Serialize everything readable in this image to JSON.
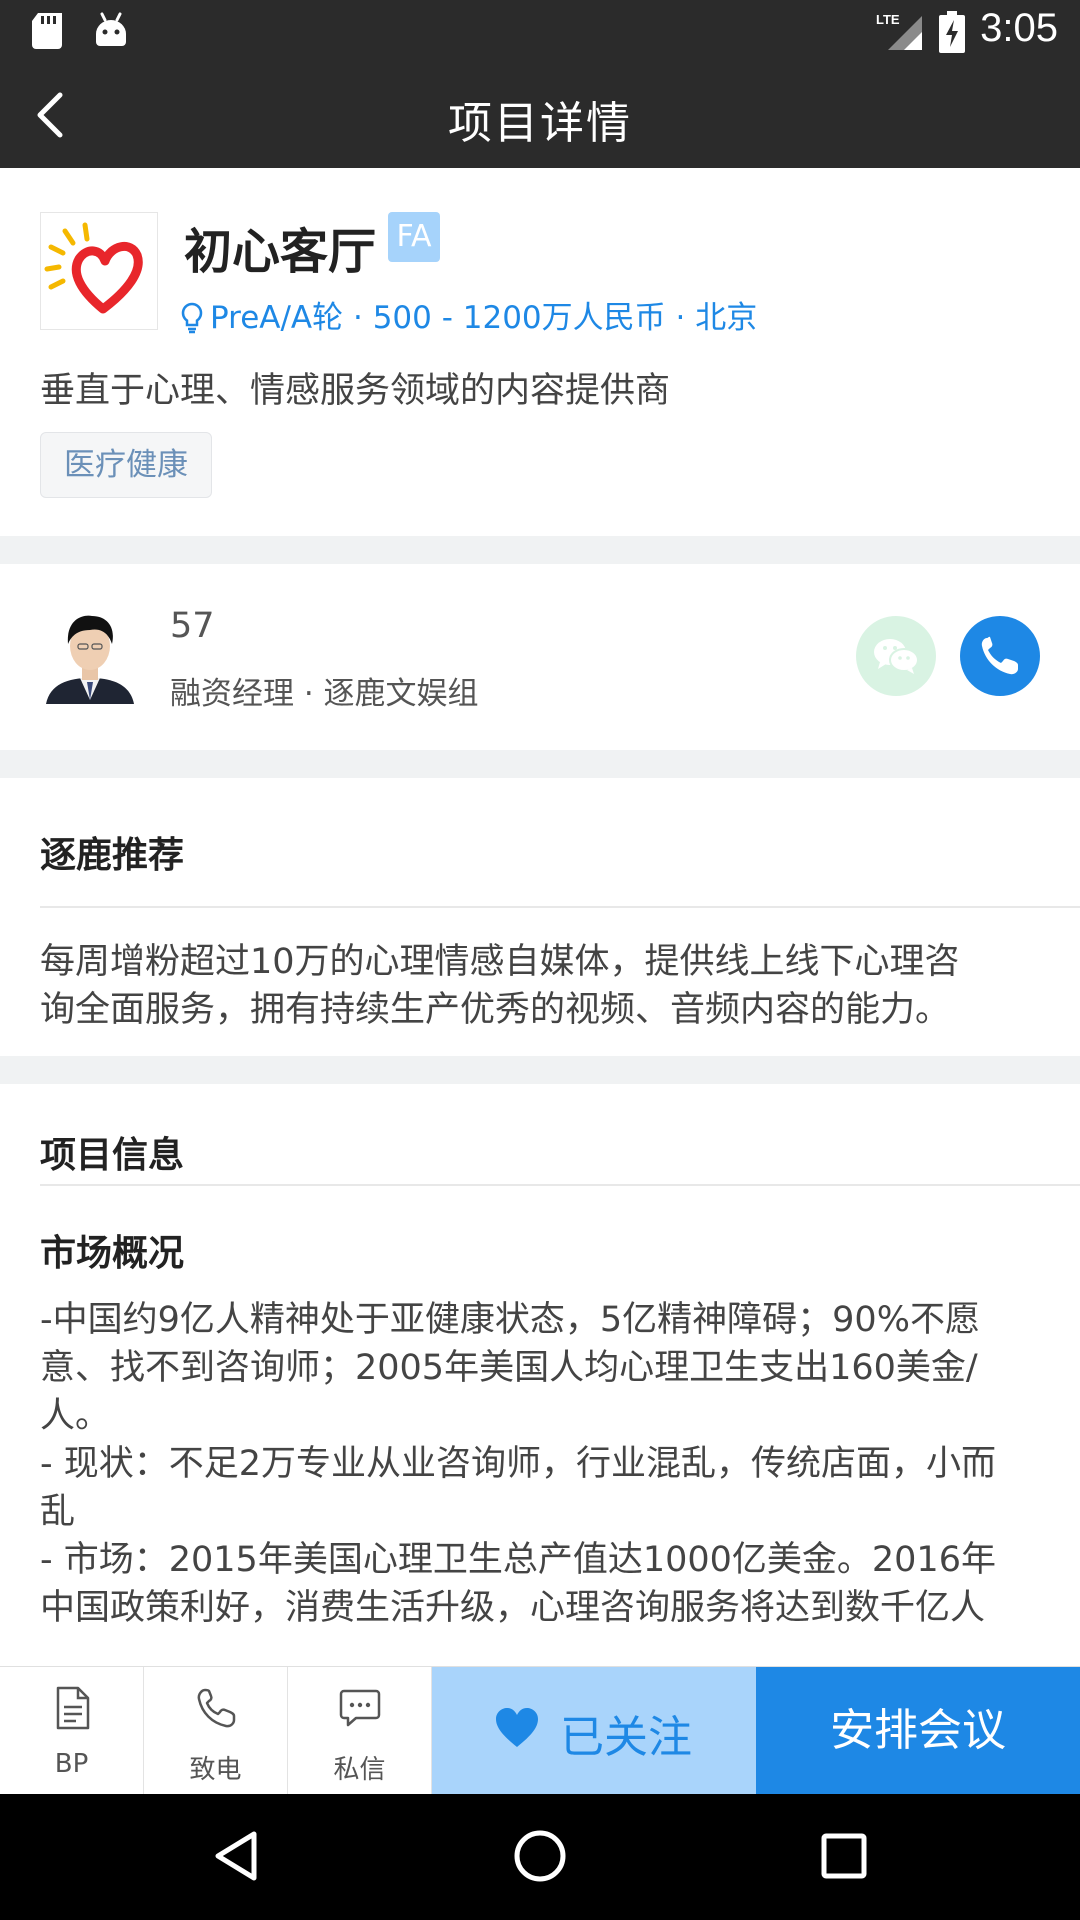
{
  "status_bar": {
    "time": "3:05",
    "network": "LTE"
  },
  "toolbar": {
    "title": "项目详情"
  },
  "project": {
    "name": "初心客厅",
    "badge": "FA",
    "meta": "PreA/A轮 · 500 - 1200万人民币 · 北京",
    "tagline": "垂直于心理、情感服务领域的内容提供商",
    "tag": "医疗健康"
  },
  "contact": {
    "number": "57",
    "role": "融资经理 · 逐鹿文娱组"
  },
  "recommend": {
    "title": "逐鹿推荐",
    "line1": "每周增粉超过10万的心理情感自媒体，提供线上线下心理咨",
    "line2": "询全面服务，拥有持续生产优秀的视频、音频内容的能力。"
  },
  "project_info": {
    "title": "项目信息",
    "market_title": "市场概况",
    "lines": [
      "-中国约9亿人精神处于亚健康状态，5亿精神障碍；90%不愿",
      "意、找不到咨询师；2005年美国人均心理卫生支出160美金/",
      "人。",
      "- 现状：不足2万专业从业咨询师，行业混乱，传统店面，小而",
      "乱",
      "- 市场：2015年美国心理卫生总产值达1000亿美金。2016年",
      "中国政策利好，消费生活升级，心理咨询服务将达到数千亿人"
    ]
  },
  "bottom_bar": {
    "bp": "BP",
    "call": "致电",
    "message": "私信",
    "follow": "已关注",
    "meeting": "安排会议"
  },
  "colors": {
    "accent": "#1e88e5",
    "follow_bg": "#a9d4fb",
    "dark_bar": "#2b2b2b"
  }
}
